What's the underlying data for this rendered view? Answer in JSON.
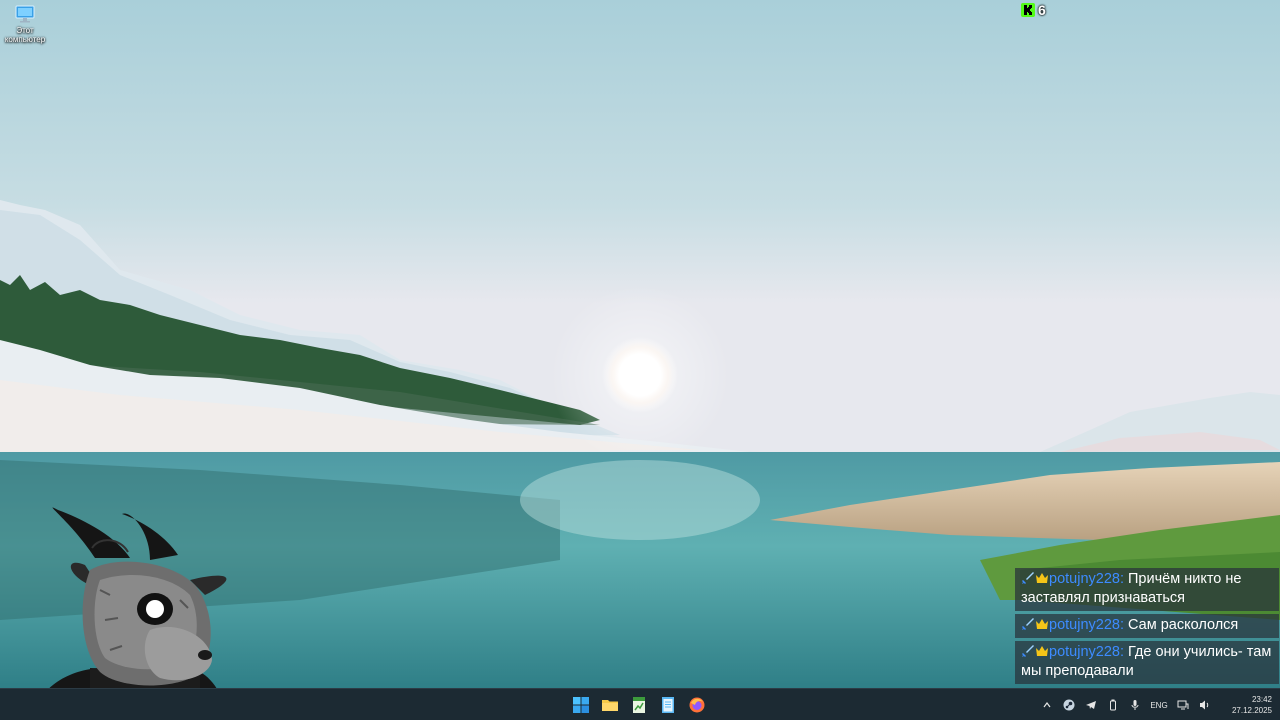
{
  "desktop": {
    "icons": [
      {
        "label": "Этот компьютер",
        "icon": "this-pc-icon"
      }
    ]
  },
  "widget": {
    "badge": "K",
    "count": "6",
    "color": "#53fc18"
  },
  "chat": {
    "messages": [
      {
        "user": "potujny228:",
        "text": " Причём никто не заставлял признаваться"
      },
      {
        "user": "potujny228:",
        "text": " Сам раскололся"
      },
      {
        "user": "potujny228:",
        "text": " Где они учились- там мы преподавали"
      }
    ],
    "username_color": "#3d8bff"
  },
  "taskbar": {
    "apps": [
      "start-icon",
      "file-explorer-icon",
      "spreadsheet-icon",
      "notepad-icon",
      "firefox-icon"
    ],
    "tray": {
      "language": "ENG",
      "time": "23:42",
      "date": "27.12.2025"
    }
  }
}
